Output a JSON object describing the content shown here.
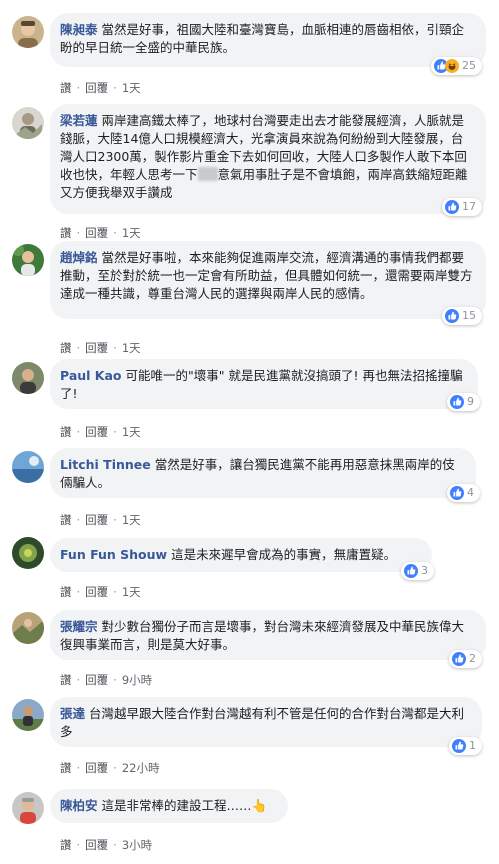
{
  "actions": {
    "like": "讚",
    "reply": "回覆",
    "sep": "·"
  },
  "colors": {
    "author": "#385898",
    "bubble": "#f2f3f5",
    "like_blue": "#4080ff",
    "haha_yellow": "#f7b125"
  },
  "comments": [
    {
      "author": "陳昶泰",
      "text": "當然是好事，祖國大陸和臺灣寶島，血脈相連的唇齒相依，引頸企盼的早日統一全盛的中華民族。",
      "time": "1天",
      "reactions": {
        "icons": [
          "like-icon",
          "haha-icon"
        ],
        "count": "25"
      }
    },
    {
      "author": "梁若蓮",
      "text_before": "兩岸建高鐵太棒了，地球村台灣要走出去才能發展經濟，人脈就是錢脈，大陸14億人口規模經濟大，光拿演員來說為何紛紛到大陸發展，台灣人口2300萬，製作影片重金下去如何回收，大陸人口多製作人敢下本回收也快，年輕人思考一下",
      "text_after": "意氣用事肚子是不會填飽，兩岸高鉄縮短距離又方便我舉双手讚成",
      "time": "1天",
      "reactions": {
        "icons": [
          "like-icon"
        ],
        "count": "17"
      }
    },
    {
      "author": "趙焯銘",
      "text": "當然是好事啦，本來能夠促進兩岸交流，經濟溝通的事情我們都要推動，至於對於統一也一定會有所助益，但具體如何統一，還需要兩岸雙方達成一種共識，尊重台灣人民的選擇與兩岸人民的感情。",
      "time": "1天",
      "reactions": {
        "icons": [
          "like-icon"
        ],
        "count": "15"
      }
    },
    {
      "author": "Paul Kao",
      "text": "可能唯一的\"壞事\" 就是民進黨就沒搞頭了! 再也無法招搖撞騙了!",
      "time": "1天",
      "reactions": {
        "icons": [
          "like-icon"
        ],
        "count": "9"
      }
    },
    {
      "author": "Litchi Tinnee",
      "text": "當然是好事，讓台獨民進黨不能再用惡意抹黑兩岸的伎倆騙人。",
      "time": "1天",
      "reactions": {
        "icons": [
          "like-icon"
        ],
        "count": "4"
      }
    },
    {
      "author": "Fun Fun Shouw",
      "text": "這是未來遲早會成為的事實，無庸置疑。",
      "time": "1天",
      "reactions": {
        "icons": [
          "like-icon"
        ],
        "count": "3"
      }
    },
    {
      "author": "張耀宗",
      "text": "對少數台獨份子而言是壞事，對台灣未來經濟發展及中華民族偉大復興事業而言，則是莫大好事。",
      "time": "9小時",
      "reactions": {
        "icons": [
          "like-icon"
        ],
        "count": "2"
      }
    },
    {
      "author": "張達",
      "text": "台灣越早跟大陸合作對台灣越有利不管是任何的合作對台灣都是大利多",
      "time": "22小時",
      "reactions": {
        "icons": [
          "like-icon"
        ],
        "count": "1"
      }
    },
    {
      "author": "陳柏安",
      "text": "這是非常棒的建設工程……👆",
      "time": "3小時",
      "reactions": null
    }
  ]
}
